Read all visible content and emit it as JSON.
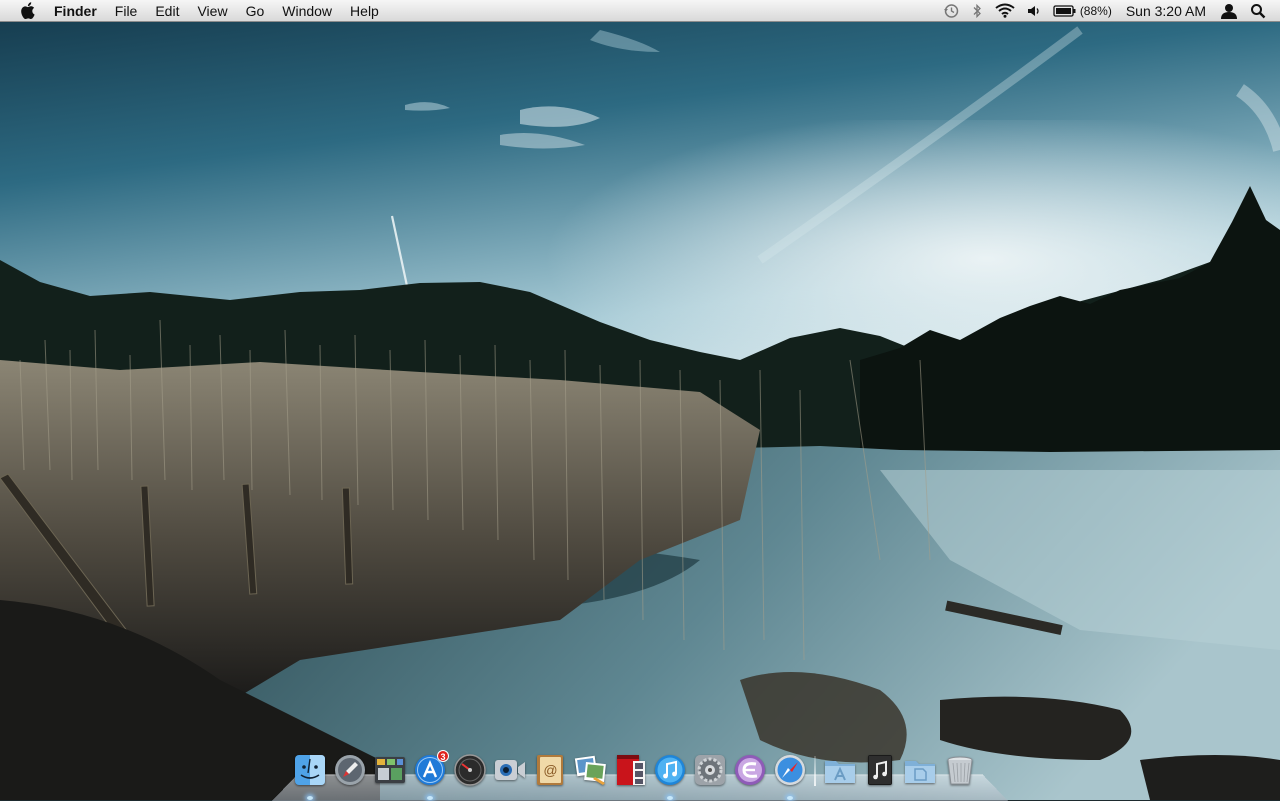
{
  "menubar": {
    "app_name": "Finder",
    "menus": [
      "File",
      "Edit",
      "View",
      "Go",
      "Window",
      "Help"
    ],
    "battery_percent": "(88%)",
    "clock": "Sun 3:20 AM",
    "status_icons": [
      "time-machine-icon",
      "bluetooth-icon",
      "wifi-icon",
      "volume-icon",
      "battery-icon",
      "user-icon",
      "spotlight-icon"
    ]
  },
  "dock": {
    "apps": [
      {
        "name": "Finder",
        "icon": "finder-icon",
        "running": true
      },
      {
        "name": "Launchpad",
        "icon": "launchpad-icon",
        "running": false
      },
      {
        "name": "Mission Control",
        "icon": "mission-control-icon",
        "running": false
      },
      {
        "name": "App Store",
        "icon": "app-store-icon",
        "running": true,
        "badge": "3"
      },
      {
        "name": "Dashboard",
        "icon": "dashboard-icon",
        "running": false
      },
      {
        "name": "FaceTime",
        "icon": "facetime-icon",
        "running": false
      },
      {
        "name": "Address Book",
        "icon": "address-book-icon",
        "running": false
      },
      {
        "name": "iPhoto",
        "icon": "iphoto-icon",
        "running": false
      },
      {
        "name": "Photo Booth",
        "icon": "photo-booth-icon",
        "running": false
      },
      {
        "name": "iTunes",
        "icon": "itunes-icon",
        "running": true
      },
      {
        "name": "System Preferences",
        "icon": "system-preferences-icon",
        "running": false
      },
      {
        "name": "Emacs",
        "icon": "emacs-icon",
        "running": false
      },
      {
        "name": "Safari",
        "icon": "safari-icon",
        "running": true
      }
    ],
    "stacks": [
      {
        "name": "Applications",
        "icon": "applications-folder-icon"
      },
      {
        "name": "Music",
        "icon": "music-folder-icon"
      },
      {
        "name": "Documents",
        "icon": "documents-folder-icon"
      },
      {
        "name": "Trash",
        "icon": "trash-icon"
      }
    ]
  },
  "colors": {
    "menubar_top": "#f6f6f6",
    "menubar_bottom": "#d9d9d9",
    "sky_top": "#1c4f64",
    "sky_horizon": "#dbe9ee",
    "lake": "#7fa3ad",
    "badge": "#e0241e"
  }
}
